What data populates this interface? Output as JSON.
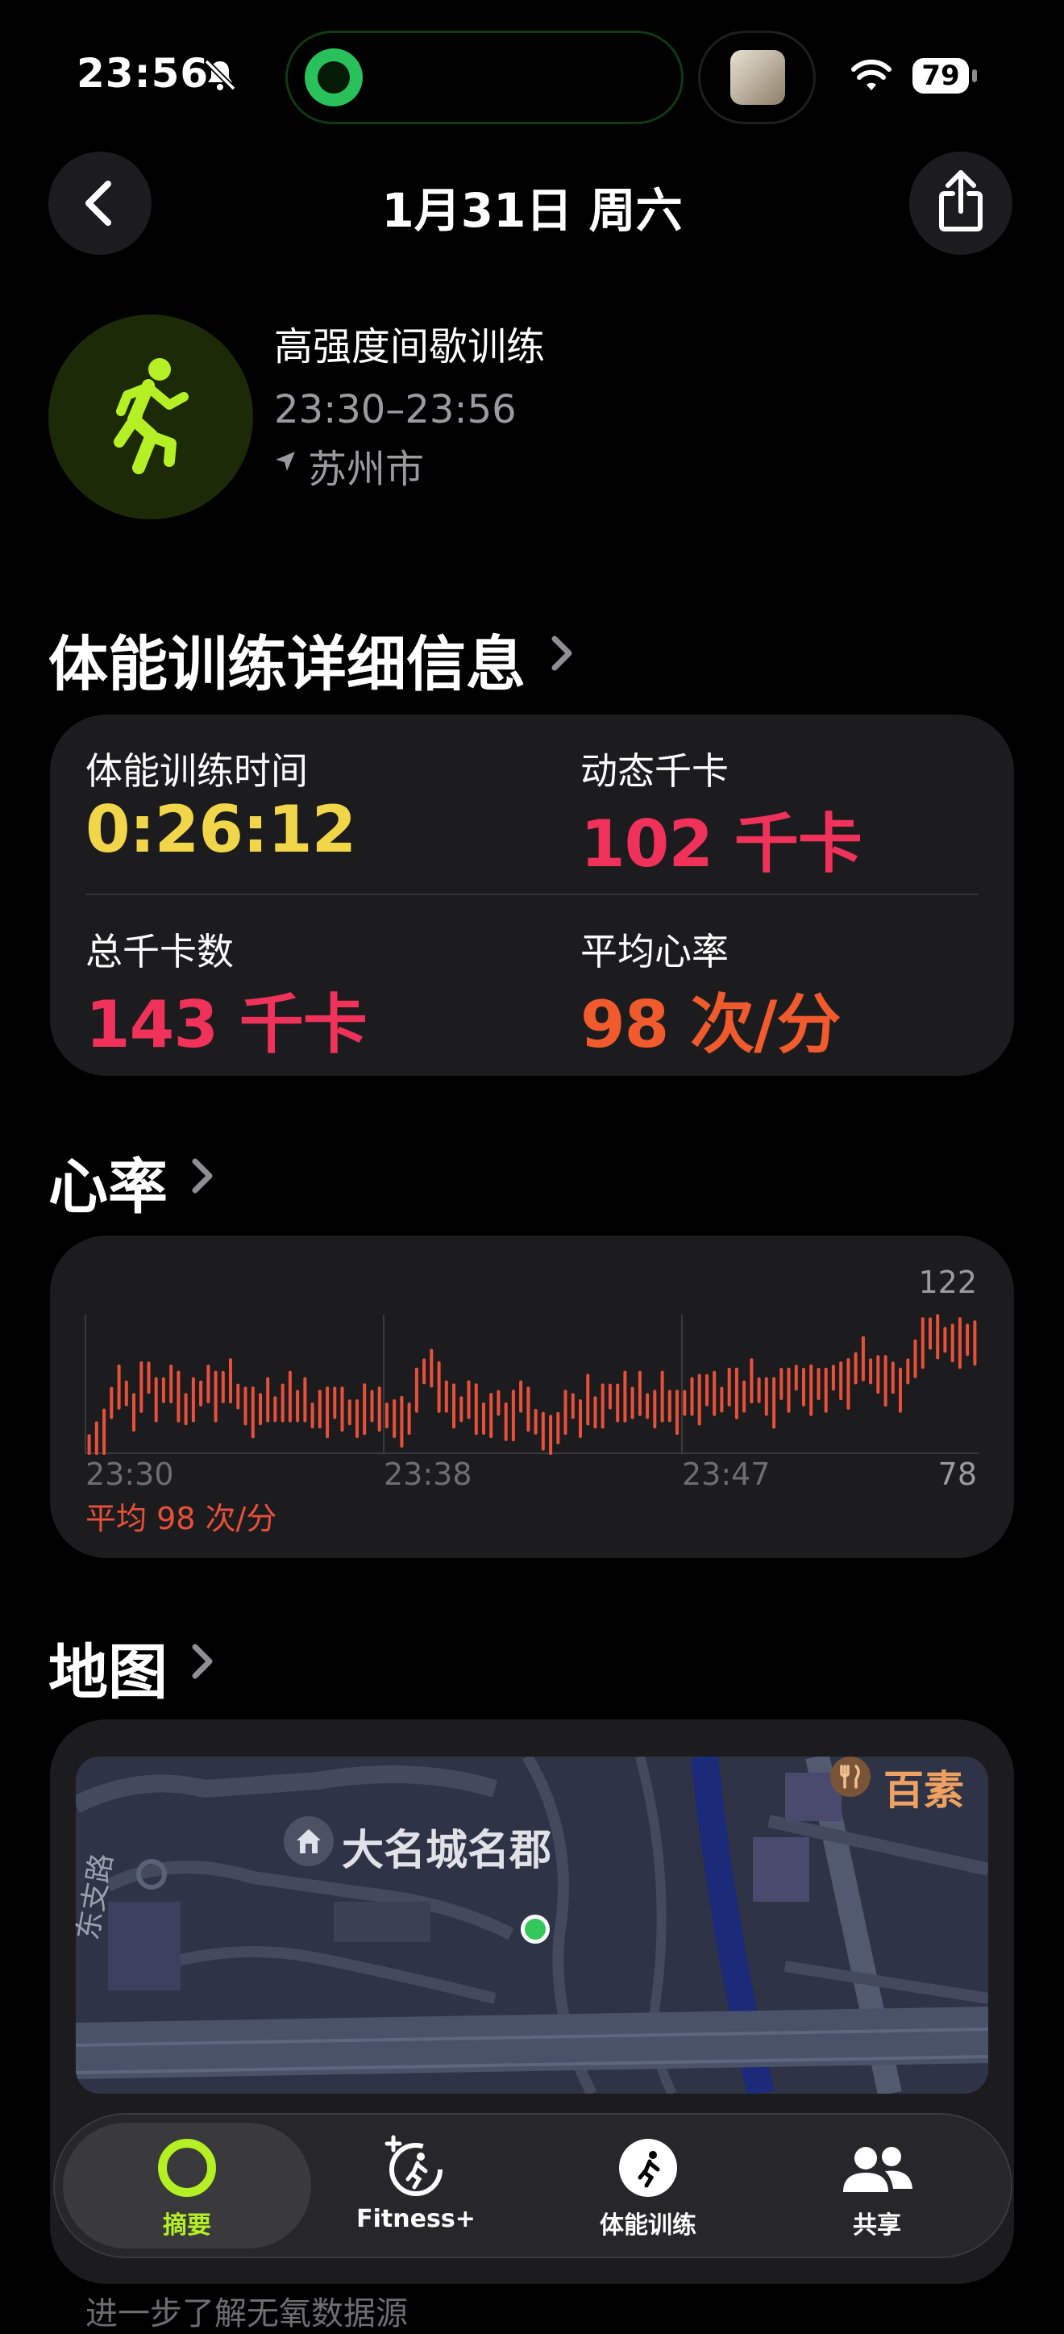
{
  "status_bar": {
    "time": "23:56",
    "battery": "79"
  },
  "nav": {
    "title": "1月31日 周六"
  },
  "workout": {
    "name": "高强度间歇训练",
    "time_range": "23:30–23:56",
    "location": "苏州市"
  },
  "details": {
    "title": "体能训练详细信息",
    "stats": [
      {
        "label": "体能训练时间",
        "value": "0:26:12",
        "color": "#f2d64a"
      },
      {
        "label": "动态千卡",
        "value": "102 千卡",
        "color": "#f0325a"
      },
      {
        "label": "总千卡数",
        "value": "143 千卡",
        "color": "#f0325a"
      },
      {
        "label": "平均心率",
        "value": "98 次/分",
        "color": "#f05a2c"
      }
    ]
  },
  "heart_rate": {
    "title": "心率",
    "max_label": "122",
    "min_label": "78",
    "x_labels": [
      "23:30",
      "23:38",
      "23:47"
    ],
    "avg_label": "平均 98 次/分"
  },
  "chart_data": {
    "type": "line",
    "ylim": [
      78,
      122
    ],
    "x_ticks": [
      "23:30",
      "23:38",
      "23:47"
    ],
    "series": [
      {
        "values": [
          80,
          82,
          84,
          94,
          99,
          97,
          91,
          99,
          102,
          95,
          98,
          100,
          96,
          92,
          95,
          97,
          100,
          96,
          99,
          101,
          96,
          93,
          91,
          92,
          95,
          92,
          94,
          96,
          93,
          95,
          90,
          92,
          91,
          94,
          92,
          91,
          89,
          92,
          93,
          92,
          90,
          89,
          88,
          89,
          98,
          104,
          105,
          99,
          96,
          93,
          92,
          95,
          92,
          89,
          90,
          94,
          88,
          90,
          96,
          92,
          88,
          85,
          82,
          86,
          91,
          93,
          89,
          95,
          91,
          93,
          96,
          94,
          96,
          94,
          97,
          93,
          92,
          96,
          93,
          91,
          94,
          96,
          95,
          98,
          97,
          95,
          99,
          97,
          96,
          101,
          98,
          96,
          94,
          100,
          98,
          102,
          99,
          98,
          100,
          98,
          102,
          101,
          100,
          105,
          108,
          104,
          103,
          101,
          102,
          98,
          104,
          108,
          113,
          116,
          115,
          114,
          113,
          113,
          114,
          113
        ]
      }
    ]
  },
  "map": {
    "title": "地图",
    "labels": [
      "大名城名郡",
      "百素",
      "东支路"
    ]
  },
  "tabs": [
    {
      "label": "摘要",
      "active": true
    },
    {
      "label": "Fitness+",
      "active": false
    },
    {
      "label": "体能训练",
      "active": false
    },
    {
      "label": "共享",
      "active": false
    }
  ],
  "footer_text": "进一步了解无氧数据源",
  "colors": {
    "accent_green": "#b4f024",
    "card": "#1c1c1e",
    "hr_red": "#e8503a"
  }
}
